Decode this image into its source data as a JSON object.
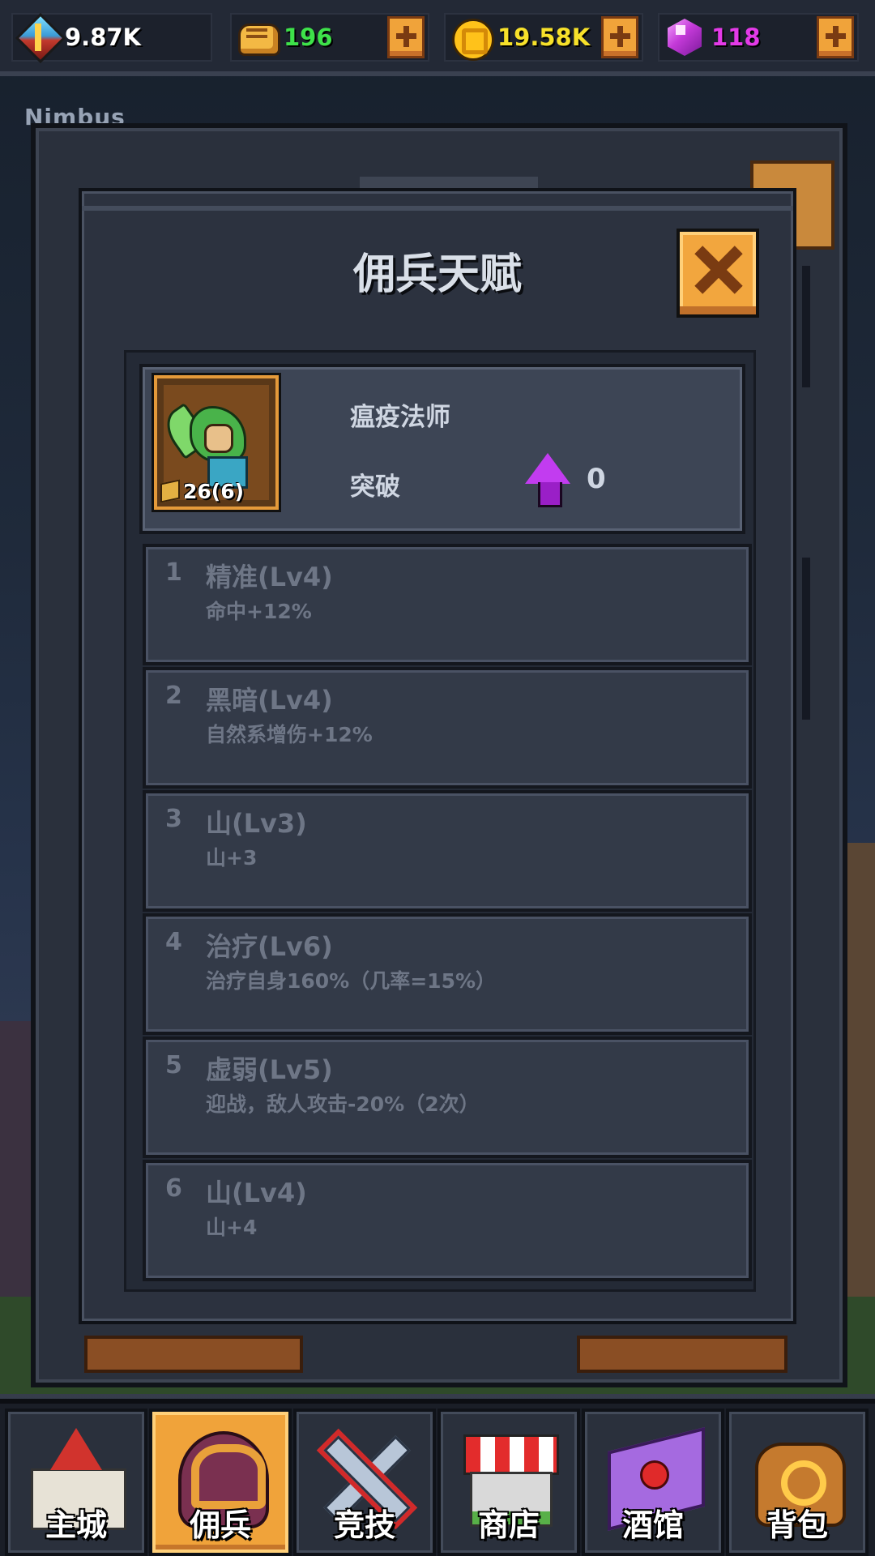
{
  "background": {
    "label": "Nimbus"
  },
  "resources": [
    {
      "icon": "crystal-icon",
      "value": "9.87K",
      "color": "#ffffff",
      "has_plus": false
    },
    {
      "icon": "bread-icon",
      "value": "196",
      "color": "#3ee24a",
      "has_plus": true
    },
    {
      "icon": "gold-coin-icon",
      "value": "19.58K",
      "color": "#f7e12a",
      "has_plus": true
    },
    {
      "icon": "purple-gem-icon",
      "value": "118",
      "color": "#e43ae8",
      "has_plus": true
    }
  ],
  "dialog": {
    "title": "佣兵天赋",
    "close_icon": "close-icon",
    "hero": {
      "name": "瘟疫法师",
      "level": "26(6)",
      "breakthrough_label": "突破",
      "breakthrough_icon": "purple-up-arrow-icon",
      "breakthrough_value": "0"
    },
    "talents": [
      {
        "index": "1",
        "name": "精准(Lv4)",
        "description": "命中+12%"
      },
      {
        "index": "2",
        "name": "黑暗(Lv4)",
        "description": "自然系增伤+12%"
      },
      {
        "index": "3",
        "name": "山(Lv3)",
        "description": "山+3"
      },
      {
        "index": "4",
        "name": "治疗(Lv6)",
        "description": "治疗自身160%（几率=15%）"
      },
      {
        "index": "5",
        "name": "虚弱(Lv5)",
        "description": "迎战，敌人攻击-20%（2次）"
      },
      {
        "index": "6",
        "name": "山(Lv4)",
        "description": "山+4"
      }
    ]
  },
  "bottom_nav": {
    "active": "佣兵",
    "items": [
      {
        "label": "主城",
        "icon": "castle-icon"
      },
      {
        "label": "佣兵",
        "icon": "helmet-icon"
      },
      {
        "label": "竞技",
        "icon": "crossed-swords-icon"
      },
      {
        "label": "商店",
        "icon": "shop-icon"
      },
      {
        "label": "酒馆",
        "icon": "scroll-icon"
      },
      {
        "label": "背包",
        "icon": "backpack-icon"
      }
    ]
  },
  "colors": {
    "accent_orange": "#f0a33a",
    "panel": "#2c323f",
    "muted_text": "#6e7686"
  }
}
